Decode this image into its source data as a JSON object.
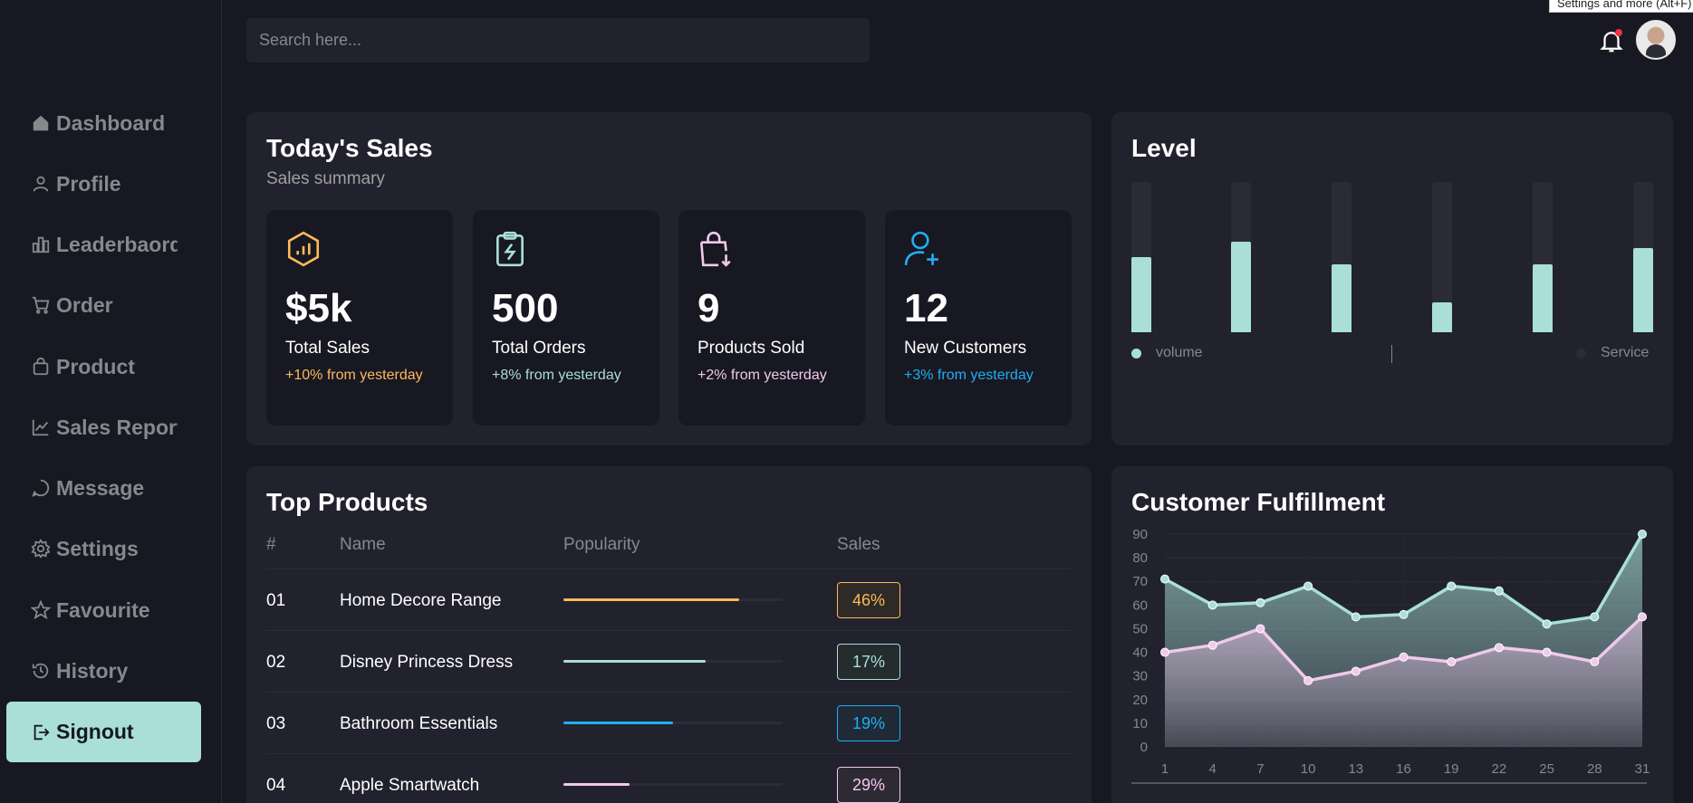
{
  "tooltip": "Settings and more (Alt+F)",
  "search": {
    "placeholder": "Search here..."
  },
  "sidebar": {
    "items": [
      {
        "label": "Dashboard",
        "icon": "home-icon"
      },
      {
        "label": "Profile",
        "icon": "user-icon"
      },
      {
        "label": "Leaderbaord",
        "icon": "bar-chart-icon"
      },
      {
        "label": "Order",
        "icon": "cart-icon"
      },
      {
        "label": "Product",
        "icon": "bag-icon"
      },
      {
        "label": "Sales Report",
        "icon": "line-chart-icon"
      },
      {
        "label": "Message",
        "icon": "message-icon"
      },
      {
        "label": "Settings",
        "icon": "gear-icon"
      },
      {
        "label": "Favourite",
        "icon": "star-icon"
      },
      {
        "label": "History",
        "icon": "history-icon"
      },
      {
        "label": "Signout",
        "icon": "signout-icon"
      }
    ]
  },
  "sales": {
    "title": "Today's Sales",
    "subtitle": "Sales summary",
    "cards": [
      {
        "value": "$5k",
        "label": "Total Sales",
        "change": "+10% from yesterday",
        "color": "#feb95a",
        "icon": "sales-hexagon-icon"
      },
      {
        "value": "500",
        "label": "Total Orders",
        "change": "+8% from yesterday",
        "color": "#a9dfd8",
        "icon": "clipboard-icon"
      },
      {
        "value": "9",
        "label": "Products Sold",
        "change": "+2% from yesterday",
        "color": "#f2c8ed",
        "icon": "shopping-bag-icon"
      },
      {
        "value": "12",
        "label": "New Customers",
        "change": "+3% from yesterday",
        "color": "#20aef3",
        "icon": "add-user-icon"
      }
    ]
  },
  "level": {
    "title": "Level",
    "legend": [
      {
        "label": "volume",
        "color": "#a9dfd8"
      },
      {
        "label": "Service",
        "color": "#2b2b36"
      }
    ],
    "bars": [
      0.5,
      0.6,
      0.45,
      0.2,
      0.45,
      0.56
    ]
  },
  "products": {
    "title": "Top Products",
    "headers": {
      "index": "#",
      "name": "Name",
      "popularity": "Popularity",
      "sales": "Sales"
    },
    "rows": [
      {
        "index": "01",
        "name": "Home Decore Range",
        "popularity": 0.8,
        "sales": "46%",
        "color": "#feb95a",
        "bg": "#2d2a27"
      },
      {
        "index": "02",
        "name": "Disney Princess Dress",
        "popularity": 0.65,
        "sales": "17%",
        "color": "#a9dfd8",
        "bg": "#252c2e"
      },
      {
        "index": "03",
        "name": "Bathroom Essentials",
        "popularity": 0.5,
        "sales": "19%",
        "color": "#20aef3",
        "bg": "#1f2a36"
      },
      {
        "index": "04",
        "name": "Apple Smartwatch",
        "popularity": 0.3,
        "sales": "29%",
        "color": "#f2c8ed",
        "bg": "#2e2a33"
      }
    ]
  },
  "fulfillment": {
    "title": "Customer Fulfillment"
  },
  "chart_data": {
    "type": "area",
    "title": "Customer Fulfillment",
    "x": [
      1,
      4,
      7,
      10,
      13,
      16,
      19,
      22,
      25,
      28,
      31
    ],
    "yticks": [
      0,
      10,
      20,
      30,
      40,
      50,
      60,
      70,
      80,
      90
    ],
    "ylim": [
      0,
      90
    ],
    "grid": true,
    "series": [
      {
        "values": [
          71,
          60,
          61,
          68,
          55,
          56,
          68,
          66,
          52,
          55,
          90
        ],
        "color": "#a9dfd8"
      },
      {
        "values": [
          40,
          43,
          50,
          28,
          32,
          38,
          36,
          42,
          40,
          36,
          55
        ],
        "color": "#f2c8ed"
      }
    ]
  }
}
